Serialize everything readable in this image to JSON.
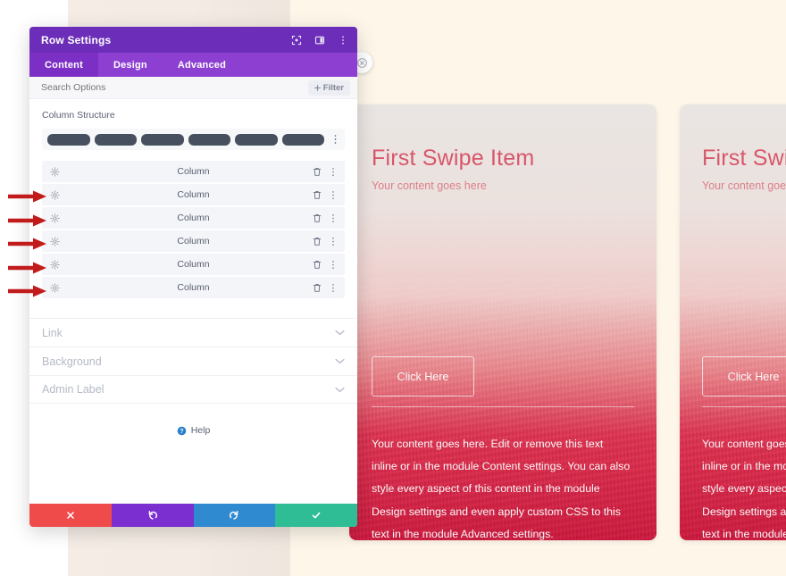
{
  "window": {
    "title": "Row Settings",
    "titlebar_icons": [
      "expand-icon",
      "layout-panel-icon",
      "more-vertical-icon"
    ]
  },
  "tabs": [
    {
      "label": "Content",
      "active": true
    },
    {
      "label": "Design",
      "active": false
    },
    {
      "label": "Advanced",
      "active": false
    }
  ],
  "search": {
    "placeholder": "Search Options",
    "value": "",
    "filter_label": "Filter",
    "filter_icon": "plus-icon"
  },
  "column_structure": {
    "label": "Column Structure",
    "segments": 6,
    "options_icon": "more-vertical-icon"
  },
  "columns": [
    {
      "name": "Column",
      "settings_icon": "gear-icon",
      "delete_icon": "trash-icon",
      "more_icon": "more-vertical-icon"
    },
    {
      "name": "Column",
      "settings_icon": "gear-icon",
      "delete_icon": "trash-icon",
      "more_icon": "more-vertical-icon"
    },
    {
      "name": "Column",
      "settings_icon": "gear-icon",
      "delete_icon": "trash-icon",
      "more_icon": "more-vertical-icon"
    },
    {
      "name": "Column",
      "settings_icon": "gear-icon",
      "delete_icon": "trash-icon",
      "more_icon": "more-vertical-icon"
    },
    {
      "name": "Column",
      "settings_icon": "gear-icon",
      "delete_icon": "trash-icon",
      "more_icon": "more-vertical-icon"
    },
    {
      "name": "Column",
      "settings_icon": "gear-icon",
      "delete_icon": "trash-icon",
      "more_icon": "more-vertical-icon"
    }
  ],
  "accordions": [
    {
      "label": "Link",
      "chevron": "chevron-down-icon"
    },
    {
      "label": "Background",
      "chevron": "chevron-down-icon"
    },
    {
      "label": "Admin Label",
      "chevron": "chevron-down-icon"
    }
  ],
  "help": {
    "label": "Help",
    "icon": "question-circle-icon"
  },
  "footer_buttons": [
    {
      "name": "cancel",
      "icon": "x-icon",
      "color": "#ef4b4b"
    },
    {
      "name": "undo",
      "icon": "undo-icon",
      "color": "#7b2fd0"
    },
    {
      "name": "redo",
      "icon": "redo-icon",
      "color": "#2f8ad0"
    },
    {
      "name": "save",
      "icon": "check-icon",
      "color": "#2ebd95"
    }
  ],
  "canvas": {
    "close_button_icon": "close-circle-icon",
    "cards": [
      {
        "title": "First Swipe Item",
        "subtitle": "Your content goes here",
        "button_label": "Click Here",
        "body": "Your content goes here. Edit or remove this text inline or in the module Content settings. You can also style every aspect of this content in the module Design settings and even apply custom CSS to this text in the module Advanced settings."
      },
      {
        "title": "First Swipe Item",
        "subtitle": "Your content goes here",
        "button_label": "Click Here",
        "body": "Your content goes here. Edit or remove this text inline or in the module Content settings. You can also style every aspect of this content in the module Design settings and even apply custom CSS to this text in the module Advanced settings."
      }
    ]
  },
  "annotations": {
    "arrow_color": "#c21b1b",
    "arrow_count": 5,
    "arrow_targets": [
      2,
      3,
      4,
      5,
      6
    ]
  },
  "colors": {
    "titlebar_purple": "#6c2eb9",
    "tabbar_purple": "#8c3fd1",
    "active_tab_purple": "#7c2fc4",
    "card_red": "#cd193e",
    "page_cream": "#fdf6e9",
    "page_beige": "#f3ebe4"
  }
}
